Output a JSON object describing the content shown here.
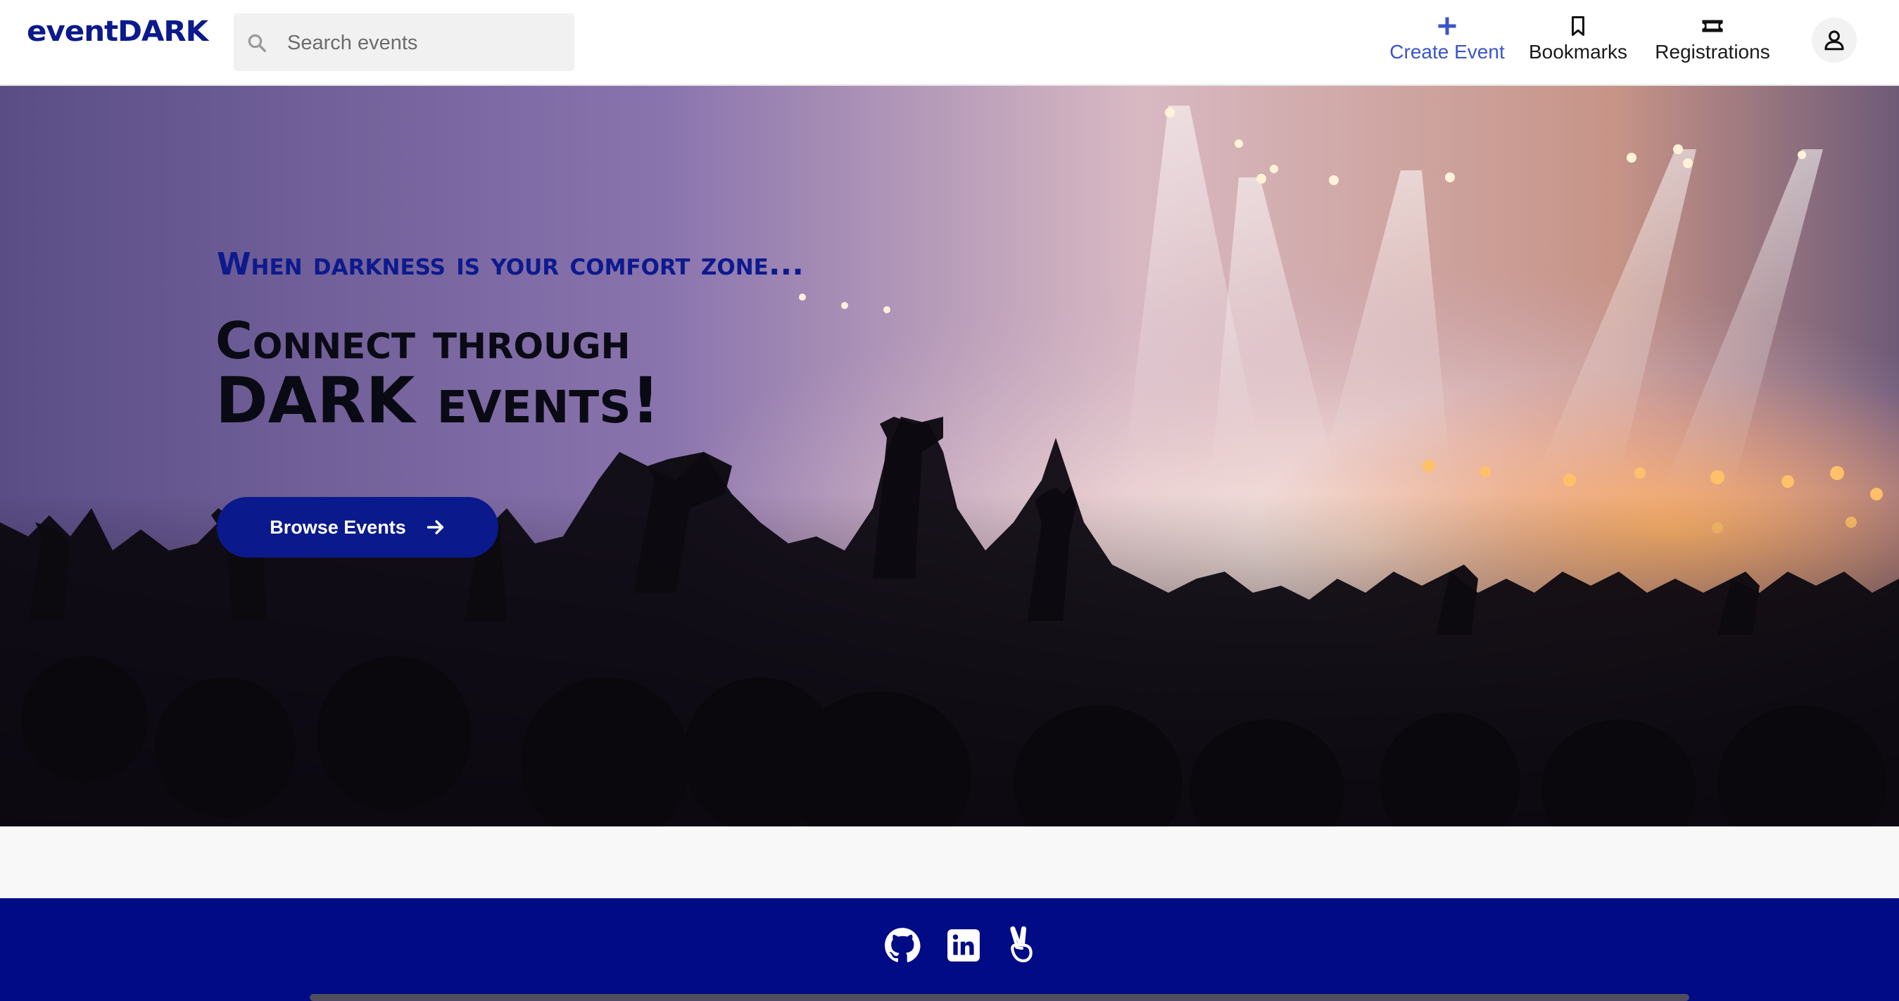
{
  "brand": {
    "logo_text": "eventDARK",
    "accent_color": "#0b1a8c"
  },
  "search": {
    "placeholder": "Search events",
    "value": ""
  },
  "nav": {
    "items": [
      {
        "label": "Create Event",
        "icon": "plus-icon",
        "color": "#3b54c7"
      },
      {
        "label": "Bookmarks",
        "icon": "bookmark-icon"
      },
      {
        "label": "Registrations",
        "icon": "ticket-icon"
      }
    ],
    "profile_icon": "user-icon"
  },
  "hero": {
    "tagline": "When darkness is your comfort zone...",
    "headline_line1": "Connect through",
    "headline_line2": "DARK events!",
    "cta_label": "Browse Events",
    "cta_icon": "arrow-right-icon",
    "background": "concert crowd photo"
  },
  "footer": {
    "background_color": "#000b85",
    "social_icons": [
      "github-icon",
      "linkedin-icon",
      "angellist-icon"
    ]
  }
}
